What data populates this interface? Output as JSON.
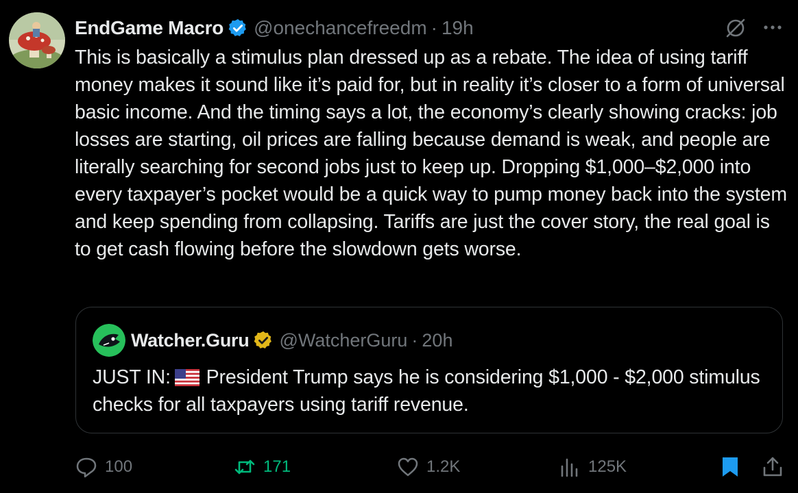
{
  "tweet": {
    "author": {
      "display_name": "EndGame Macro",
      "handle": "@onechancefreedm",
      "time": "19h",
      "verified_color": "#1d9bf0"
    },
    "text": "This is basically a stimulus plan dressed up as a rebate. The idea of using tariff money makes it sound like it’s paid for, but in reality it’s closer to a form of universal basic income. And the timing says a lot, the economy’s clearly showing cracks: job losses are starting, oil prices are falling because demand is weak, and people are literally searching for second jobs just to keep up. Dropping $1,000–$2,000 into every taxpayer’s pocket would be a quick way to pump money back into the system and keep spending from collapsing. Tariffs are just the cover story, the real goal is to get cash flowing before the slowdown gets worse."
  },
  "quote": {
    "author": {
      "display_name": "Watcher.Guru",
      "handle": "@WatcherGuru",
      "time": "20h",
      "verified_color": "#e2b719"
    },
    "text_prefix": "JUST IN:",
    "flag_icon": "us-flag-icon",
    "text_rest": "President Trump says he is considering $1,000 - $2,000 stimulus checks for all taxpayers using tariff revenue."
  },
  "actions": {
    "replies": "100",
    "retweets": "171",
    "likes": "1.2K",
    "views": "125K"
  },
  "colors": {
    "background": "#000000",
    "text": "#e7e9ea",
    "muted": "#71767b",
    "retweet_green": "#00ba7c",
    "bookmark_blue": "#1d9bf0",
    "border": "#2f3336"
  },
  "icons": [
    "grok-icon",
    "more-icon",
    "reply-icon",
    "retweet-icon",
    "like-icon",
    "views-icon",
    "bookmark-icon",
    "share-icon"
  ]
}
